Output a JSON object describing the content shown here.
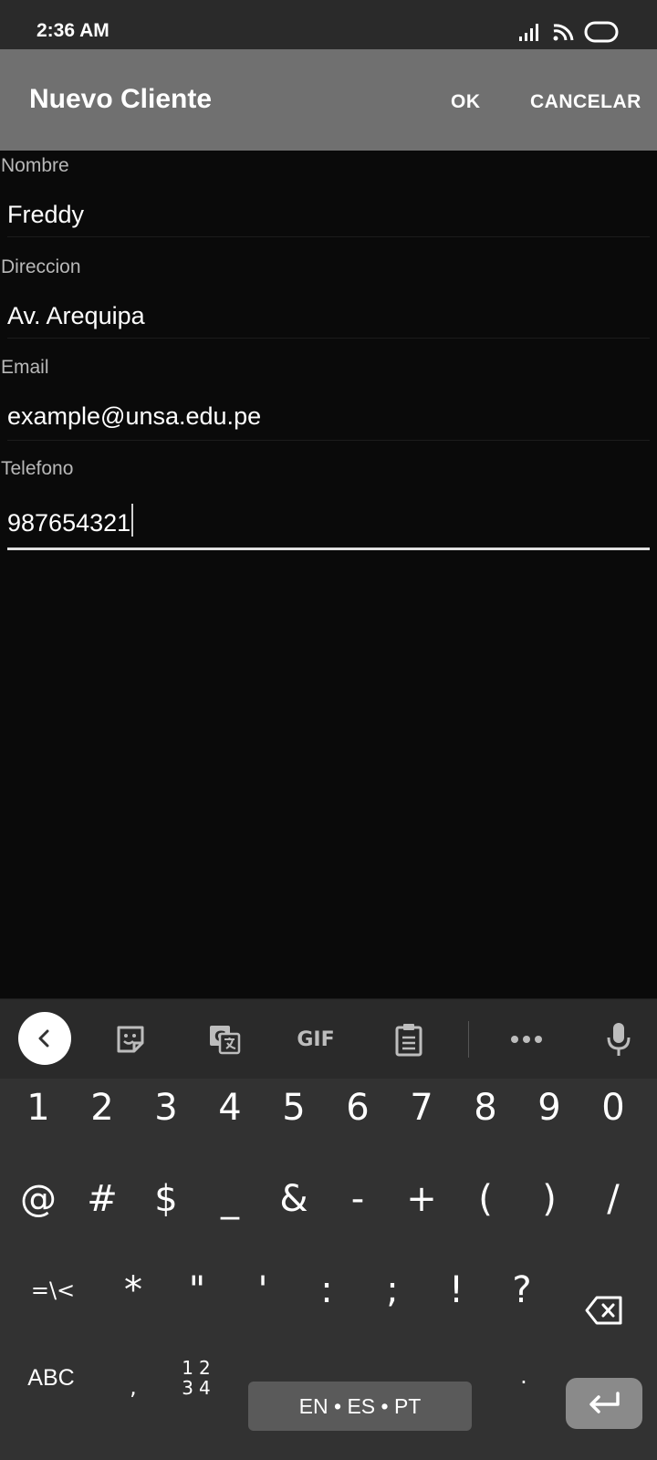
{
  "status_bar": {
    "time": "2:36 AM"
  },
  "app_bar": {
    "title": "Nuevo Cliente",
    "ok_label": "OK",
    "cancel_label": "CANCELAR"
  },
  "form": {
    "nombre": {
      "label": "Nombre",
      "value": "Freddy"
    },
    "direccion": {
      "label": "Direccion",
      "value": "Av. Arequipa"
    },
    "email": {
      "label": "Email",
      "value": "example@unsa.edu.pe"
    },
    "telefono": {
      "label": "Telefono",
      "value": "987654321"
    }
  },
  "keyboard": {
    "toolbar": {
      "gif_label": "GIF"
    },
    "row1": [
      "1",
      "2",
      "3",
      "4",
      "5",
      "6",
      "7",
      "8",
      "9",
      "0"
    ],
    "row2": [
      "@",
      "#",
      "$",
      "_",
      "&",
      "-",
      "+",
      "(",
      ")",
      "/"
    ],
    "row3": [
      "=\\<",
      "*",
      "\"",
      "'",
      ":",
      ";",
      "!",
      "?"
    ],
    "bottom": {
      "abc_label": "ABC",
      "comma": ",",
      "num_top": "12",
      "num_bottom": "34",
      "space_label": "EN • ES • PT",
      "period": "."
    }
  },
  "colors": {
    "app_bar": "#707070",
    "background": "#0a0a0a",
    "keyboard": "#323232"
  }
}
